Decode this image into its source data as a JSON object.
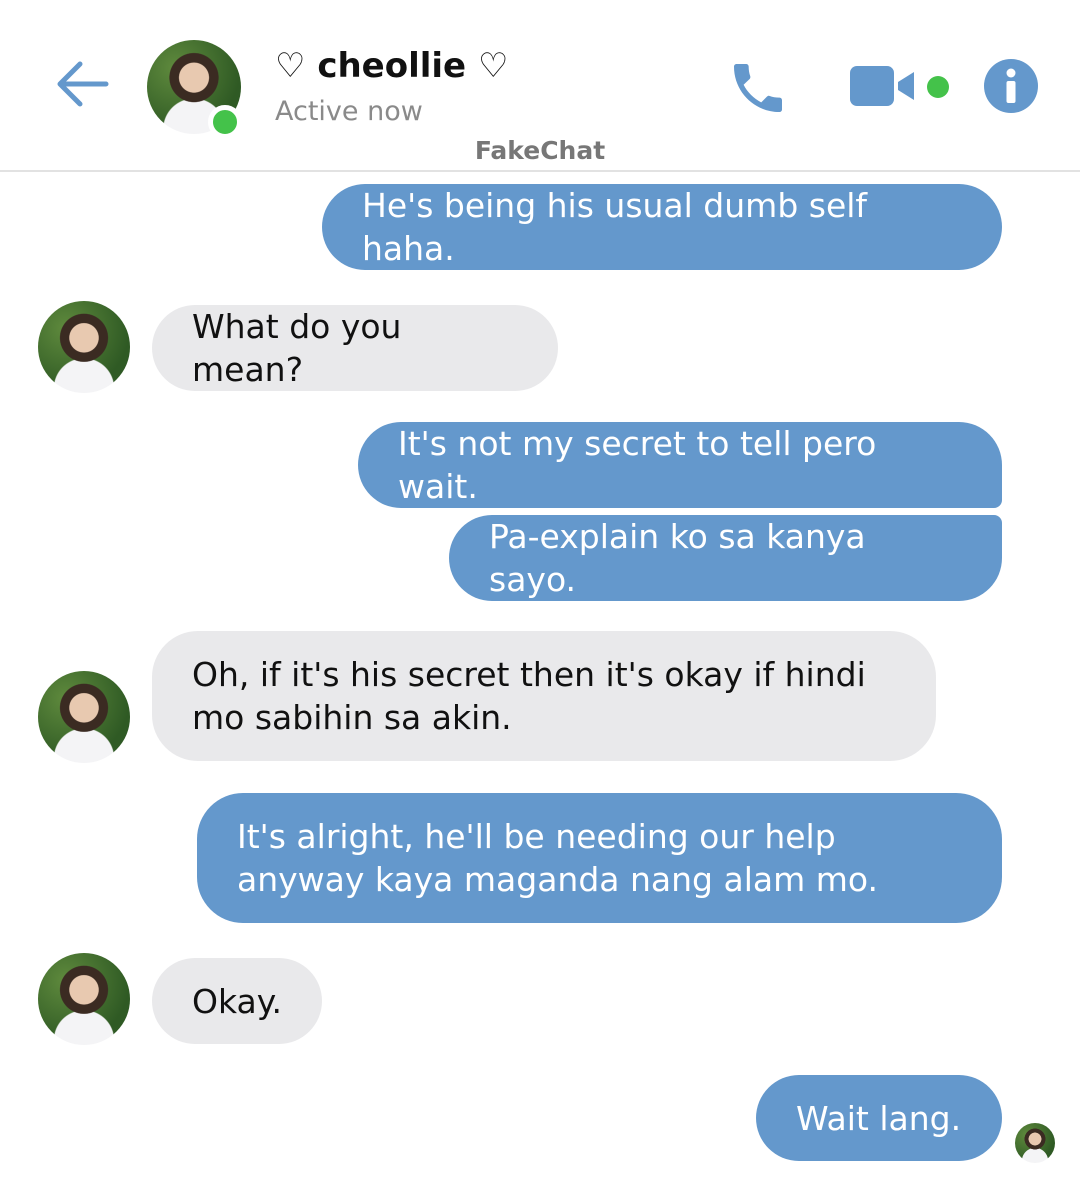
{
  "header": {
    "contact_name": "♡ cheollie ♡",
    "status": "Active now",
    "watermark": "FakeChat",
    "accent_color": "#6498cc",
    "online_color": "#44c24a",
    "icons": [
      "back-arrow-icon",
      "phone-icon",
      "video-camera-icon",
      "info-icon"
    ]
  },
  "messages": [
    {
      "from": "me",
      "text": "He's being his usual dumb self haha."
    },
    {
      "from": "contact",
      "text": "What do you mean?"
    },
    {
      "from": "me",
      "text": "It's not my secret to tell pero wait."
    },
    {
      "from": "me",
      "text": "Pa-explain ko sa kanya sayo."
    },
    {
      "from": "contact",
      "text": "Oh, if it's his secret then it's okay if hindi\nmo sabihin sa akin."
    },
    {
      "from": "me",
      "text": "It's alright, he'll be needing our help\nanyway kaya maganda nang alam mo."
    },
    {
      "from": "contact",
      "text": "Okay."
    },
    {
      "from": "me",
      "text": "Wait lang."
    }
  ]
}
